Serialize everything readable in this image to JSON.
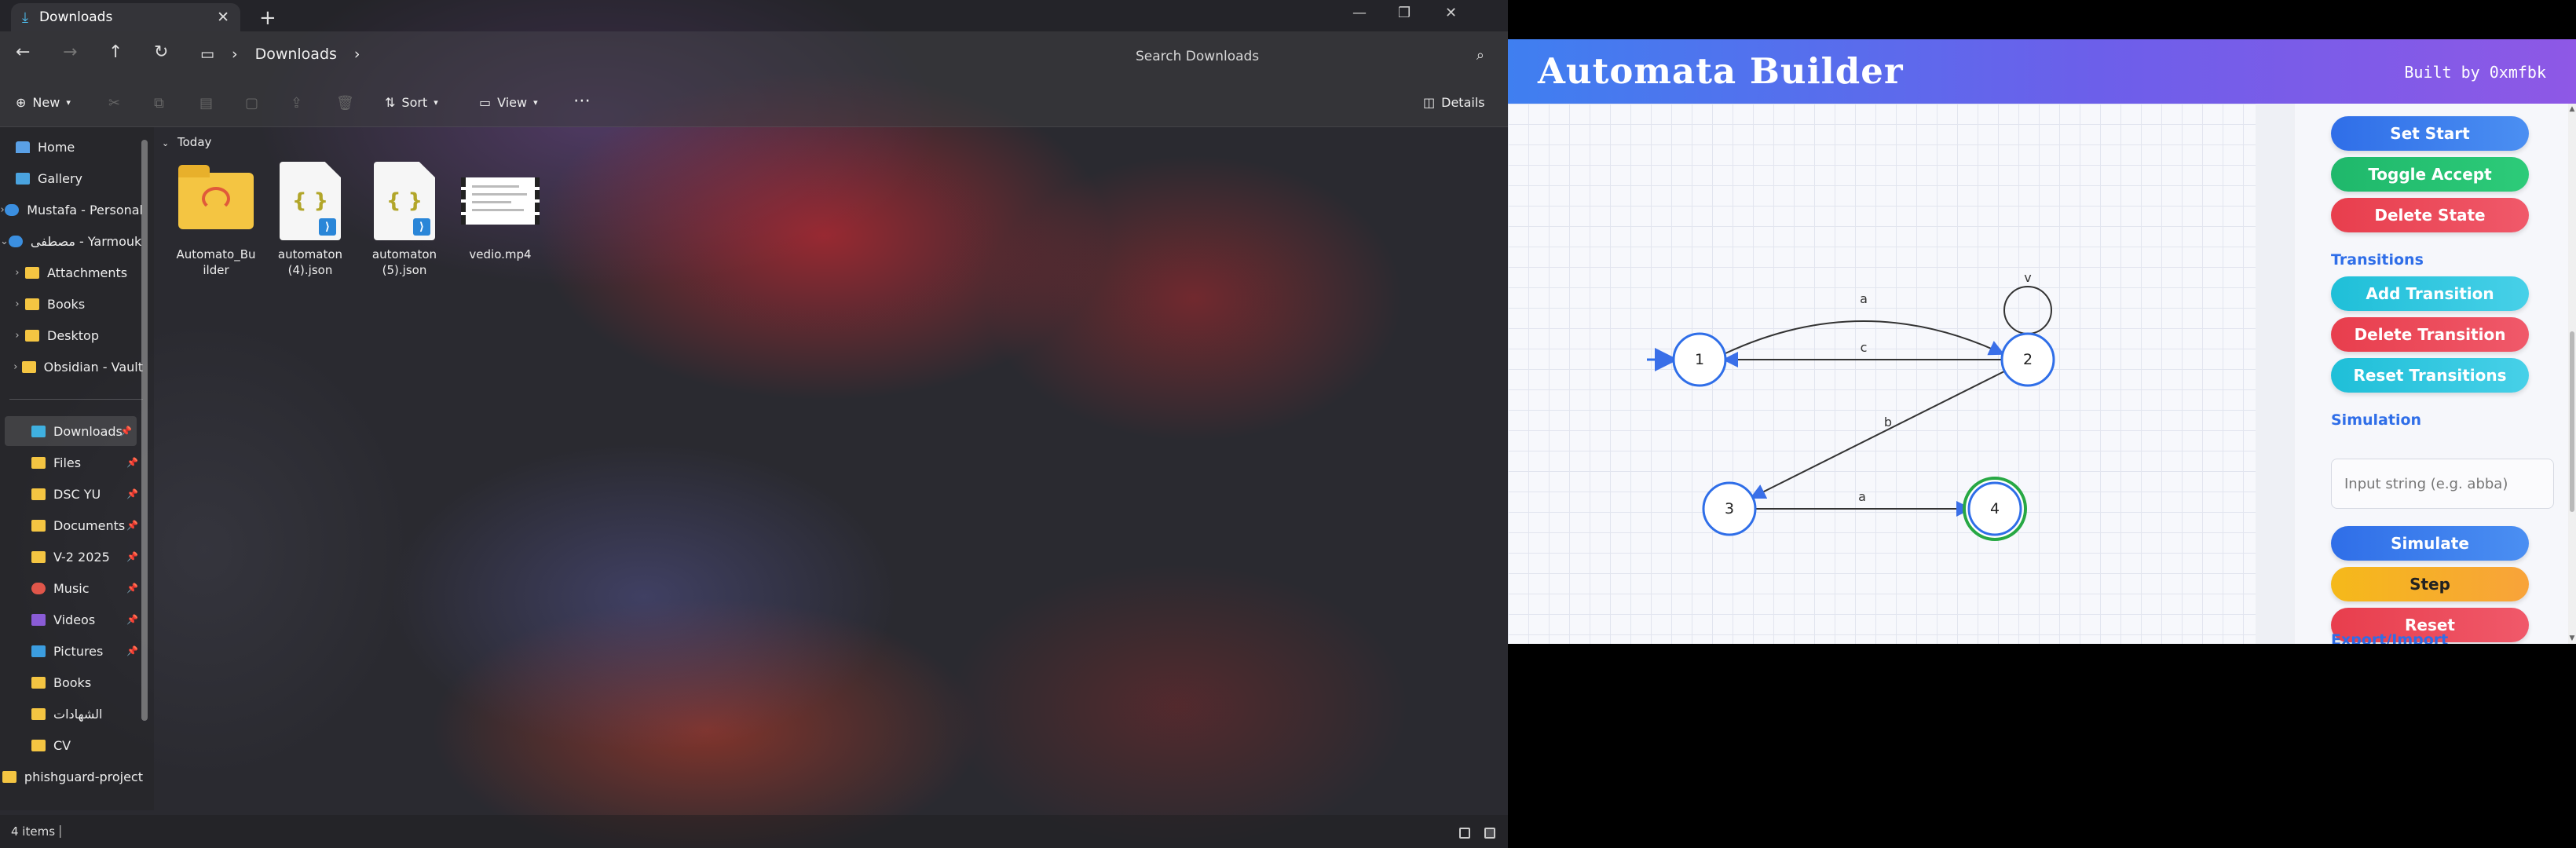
{
  "explorer": {
    "tab_title": "Downloads",
    "breadcrumb": "Downloads",
    "search_placeholder": "Search Downloads",
    "commands": {
      "new": "New",
      "sort": "Sort",
      "view": "View",
      "details": "Details"
    },
    "sidebar": {
      "items": [
        {
          "label": "Home"
        },
        {
          "label": "Gallery"
        },
        {
          "label": "Mustafa - Personal"
        },
        {
          "label": "مصطفى - Yarmouk University"
        },
        {
          "label": "Attachments"
        },
        {
          "label": "Books"
        },
        {
          "label": "Desktop"
        },
        {
          "label": "Obsidian - Vault"
        }
      ],
      "pinned": [
        {
          "label": "Downloads"
        },
        {
          "label": "Files"
        },
        {
          "label": "DSC YU"
        },
        {
          "label": "Documents"
        },
        {
          "label": "V-2 2025"
        },
        {
          "label": "Music"
        },
        {
          "label": "Videos"
        },
        {
          "label": "Pictures"
        },
        {
          "label": "Books"
        },
        {
          "label": "الشهادات"
        },
        {
          "label": "CV"
        },
        {
          "label": "phishguard-project"
        }
      ]
    },
    "group_label": "Today",
    "files": [
      {
        "name": "Automato_Builder"
      },
      {
        "name": "automaton (4).json"
      },
      {
        "name": "automaton (5).json"
      },
      {
        "name": "vedio.mp4"
      }
    ],
    "status_count": "4 items"
  },
  "app": {
    "title": "Automata Builder",
    "byline": "Built by 0xmfbk",
    "states": [
      {
        "id": "1",
        "start": true,
        "accept": false
      },
      {
        "id": "2",
        "start": false,
        "accept": false
      },
      {
        "id": "3",
        "start": false,
        "accept": false
      },
      {
        "id": "4",
        "start": false,
        "accept": true
      }
    ],
    "transitions": [
      {
        "from": "1",
        "to": "2",
        "symbol": "a"
      },
      {
        "from": "2",
        "to": "1",
        "symbol": "c"
      },
      {
        "from": "2",
        "to": "2",
        "symbol": "v"
      },
      {
        "from": "2",
        "to": "3",
        "symbol": "b"
      },
      {
        "from": "3",
        "to": "4",
        "symbol": "a"
      }
    ],
    "panel": {
      "set_start": "Set Start",
      "toggle_accept": "Toggle Accept",
      "delete_state": "Delete State",
      "transitions_heading": "Transitions",
      "add_transition": "Add Transition",
      "delete_transition": "Delete Transition",
      "reset_transitions": "Reset Transitions",
      "simulation_heading": "Simulation",
      "input_placeholder": "Input string (e.g. abba)",
      "simulate": "Simulate",
      "step": "Step",
      "reset": "Reset",
      "export_heading": "Export/Import"
    },
    "colors": {
      "accent": "#2f6ee8",
      "accept_ring": "#27a844",
      "state_border": "#2f6ee8"
    }
  }
}
